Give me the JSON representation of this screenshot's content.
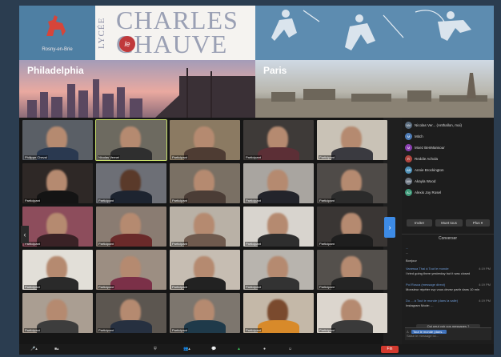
{
  "banner": {
    "logo_caption": "Rosny-en-Brie",
    "school_prefix": "LYCÉE",
    "school_name_1": "CHARLES",
    "school_name_2": "CHAUVE",
    "school_le": "le",
    "city_left": "Philadelphia",
    "city_right": "Paris"
  },
  "participants_panel": {
    "items": [
      {
        "initials": "NV",
        "name": "Nicolas Ver... (Anthallon, moi)"
      },
      {
        "initials": "M",
        "name": "Mitch"
      },
      {
        "initials": "M",
        "name": "Moez BenMansour"
      },
      {
        "initials": "R",
        "name": "Reddie Achola"
      },
      {
        "initials": "AB",
        "name": "Annie Brockington"
      },
      {
        "initials": "AW",
        "name": "Akayla Wood"
      },
      {
        "initials": "AJ",
        "name": "Alexis Joy Rosel"
      }
    ],
    "invite_label": "Inviter",
    "mute_all_label": "Muet tous",
    "more_label": "Plus ▾"
  },
  "chat": {
    "header": "Converser",
    "messages": [
      {
        "meta": "...",
        "text": "...",
        "time": ""
      },
      {
        "meta": "",
        "text": "Bonjour",
        "time": ""
      },
      {
        "meta": "Vanessa Thai à Tout le monde",
        "text": "",
        "time": "4:19 PM"
      },
      {
        "meta": "",
        "text": "I tried going there yesterday but it was closed",
        "time": ""
      },
      {
        "meta": "Pol Rosca (message direct)",
        "text": "",
        "time": "4:19 PM"
      },
      {
        "meta": "",
        "text": "Monsieur répéter svp vous devez partir dans 10 min",
        "time": ""
      },
      {
        "meta": "Do ... à Tout le monde (dans la salle)",
        "text": "",
        "time": "4:19 PM"
      },
      {
        "meta": "",
        "text": "Instagram Mode: ...",
        "time": ""
      }
    ],
    "quiz_label": "Qui peut voir vos messages ?",
    "to_label": "À :",
    "to_value": "Tout le monde (dans...",
    "input_placeholder": "Saisir le message ici..."
  },
  "toolbar": {
    "end_label": "Fin"
  },
  "colors": {
    "banner_blue": "#6f9ab8",
    "brand_red": "#c0393b",
    "active_tile": "#c8e06a",
    "accent_blue": "#3d8be6"
  },
  "grid": {
    "tiles": [
      {
        "name": "Philippe Cheval"
      },
      {
        "name": "Nicolas Vernet"
      },
      {
        "name": "Participant"
      },
      {
        "name": "Participant"
      },
      {
        "name": "Participant"
      },
      {
        "name": "Participant"
      },
      {
        "name": "Participant"
      },
      {
        "name": "Participant"
      },
      {
        "name": "Participant"
      },
      {
        "name": "Participant"
      },
      {
        "name": "Participant"
      },
      {
        "name": "Participant"
      },
      {
        "name": "Participant"
      },
      {
        "name": "Participant"
      },
      {
        "name": "Participant"
      },
      {
        "name": "Participant"
      },
      {
        "name": "Participant"
      },
      {
        "name": "Participant"
      },
      {
        "name": "Participant"
      },
      {
        "name": "Participant"
      },
      {
        "name": "Participant"
      },
      {
        "name": "Participant"
      },
      {
        "name": "Participant"
      },
      {
        "name": "Participant"
      },
      {
        "name": "Participant"
      }
    ]
  }
}
